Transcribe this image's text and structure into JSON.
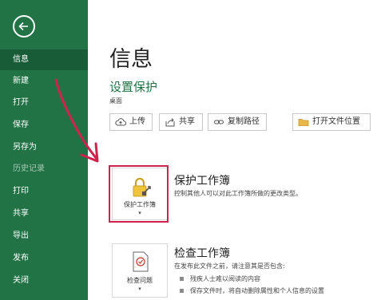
{
  "sidebar": {
    "items": [
      {
        "label": "信息",
        "active": true
      },
      {
        "label": "新建"
      },
      {
        "label": "打开"
      },
      {
        "label": "保存"
      },
      {
        "label": "另存为"
      },
      {
        "label": "历史记录",
        "disabled": true
      },
      {
        "label": "打印"
      },
      {
        "label": "共享"
      },
      {
        "label": "导出"
      },
      {
        "label": "发布"
      },
      {
        "label": "关闭"
      }
    ]
  },
  "main": {
    "title": "信息",
    "section_title": "设置保护",
    "section_sub": "桌面",
    "actions": [
      "上传",
      "共享",
      "复制路径",
      "打开文件位置"
    ],
    "protect": {
      "tile_label": "保护工作簿",
      "title": "保护工作簿",
      "desc": "控制其他人可以对此工作簿所做的更改类型。"
    },
    "inspect": {
      "tile_label": "检查问题",
      "title": "检查工作簿",
      "desc": "在发布此文件之前，请注意其是否包含:",
      "bullets": [
        "残疾人士难以阅读的内容",
        "保存文件时，将自动删除属性和个人信息的设置"
      ]
    },
    "caret": "▾"
  },
  "colors": {
    "sidebar": "#217346",
    "active": "#185c37",
    "accent": "#217346",
    "highlight": "#d0224c"
  }
}
